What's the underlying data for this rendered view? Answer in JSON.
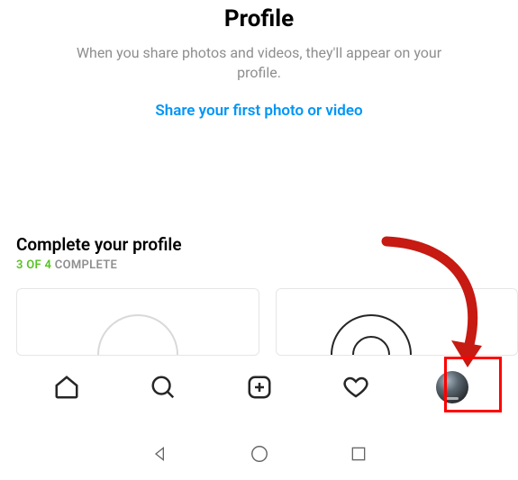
{
  "header": {
    "title": "Profile",
    "subtitle": "When you share photos and videos, they'll appear on your profile.",
    "share_link": "Share your first photo or video"
  },
  "complete": {
    "title": "Complete your profile",
    "done": "3 OF 4",
    "total_suffix": " COMPLETE"
  },
  "nav": {
    "home": "Home",
    "search": "Search",
    "create": "Create",
    "activity": "Activity",
    "profile": "Profile"
  },
  "sysnav": {
    "back": "Back",
    "home": "Home",
    "recent": "Recent"
  },
  "tutorial": {
    "arrow": "pointer-to-profile-tab"
  }
}
